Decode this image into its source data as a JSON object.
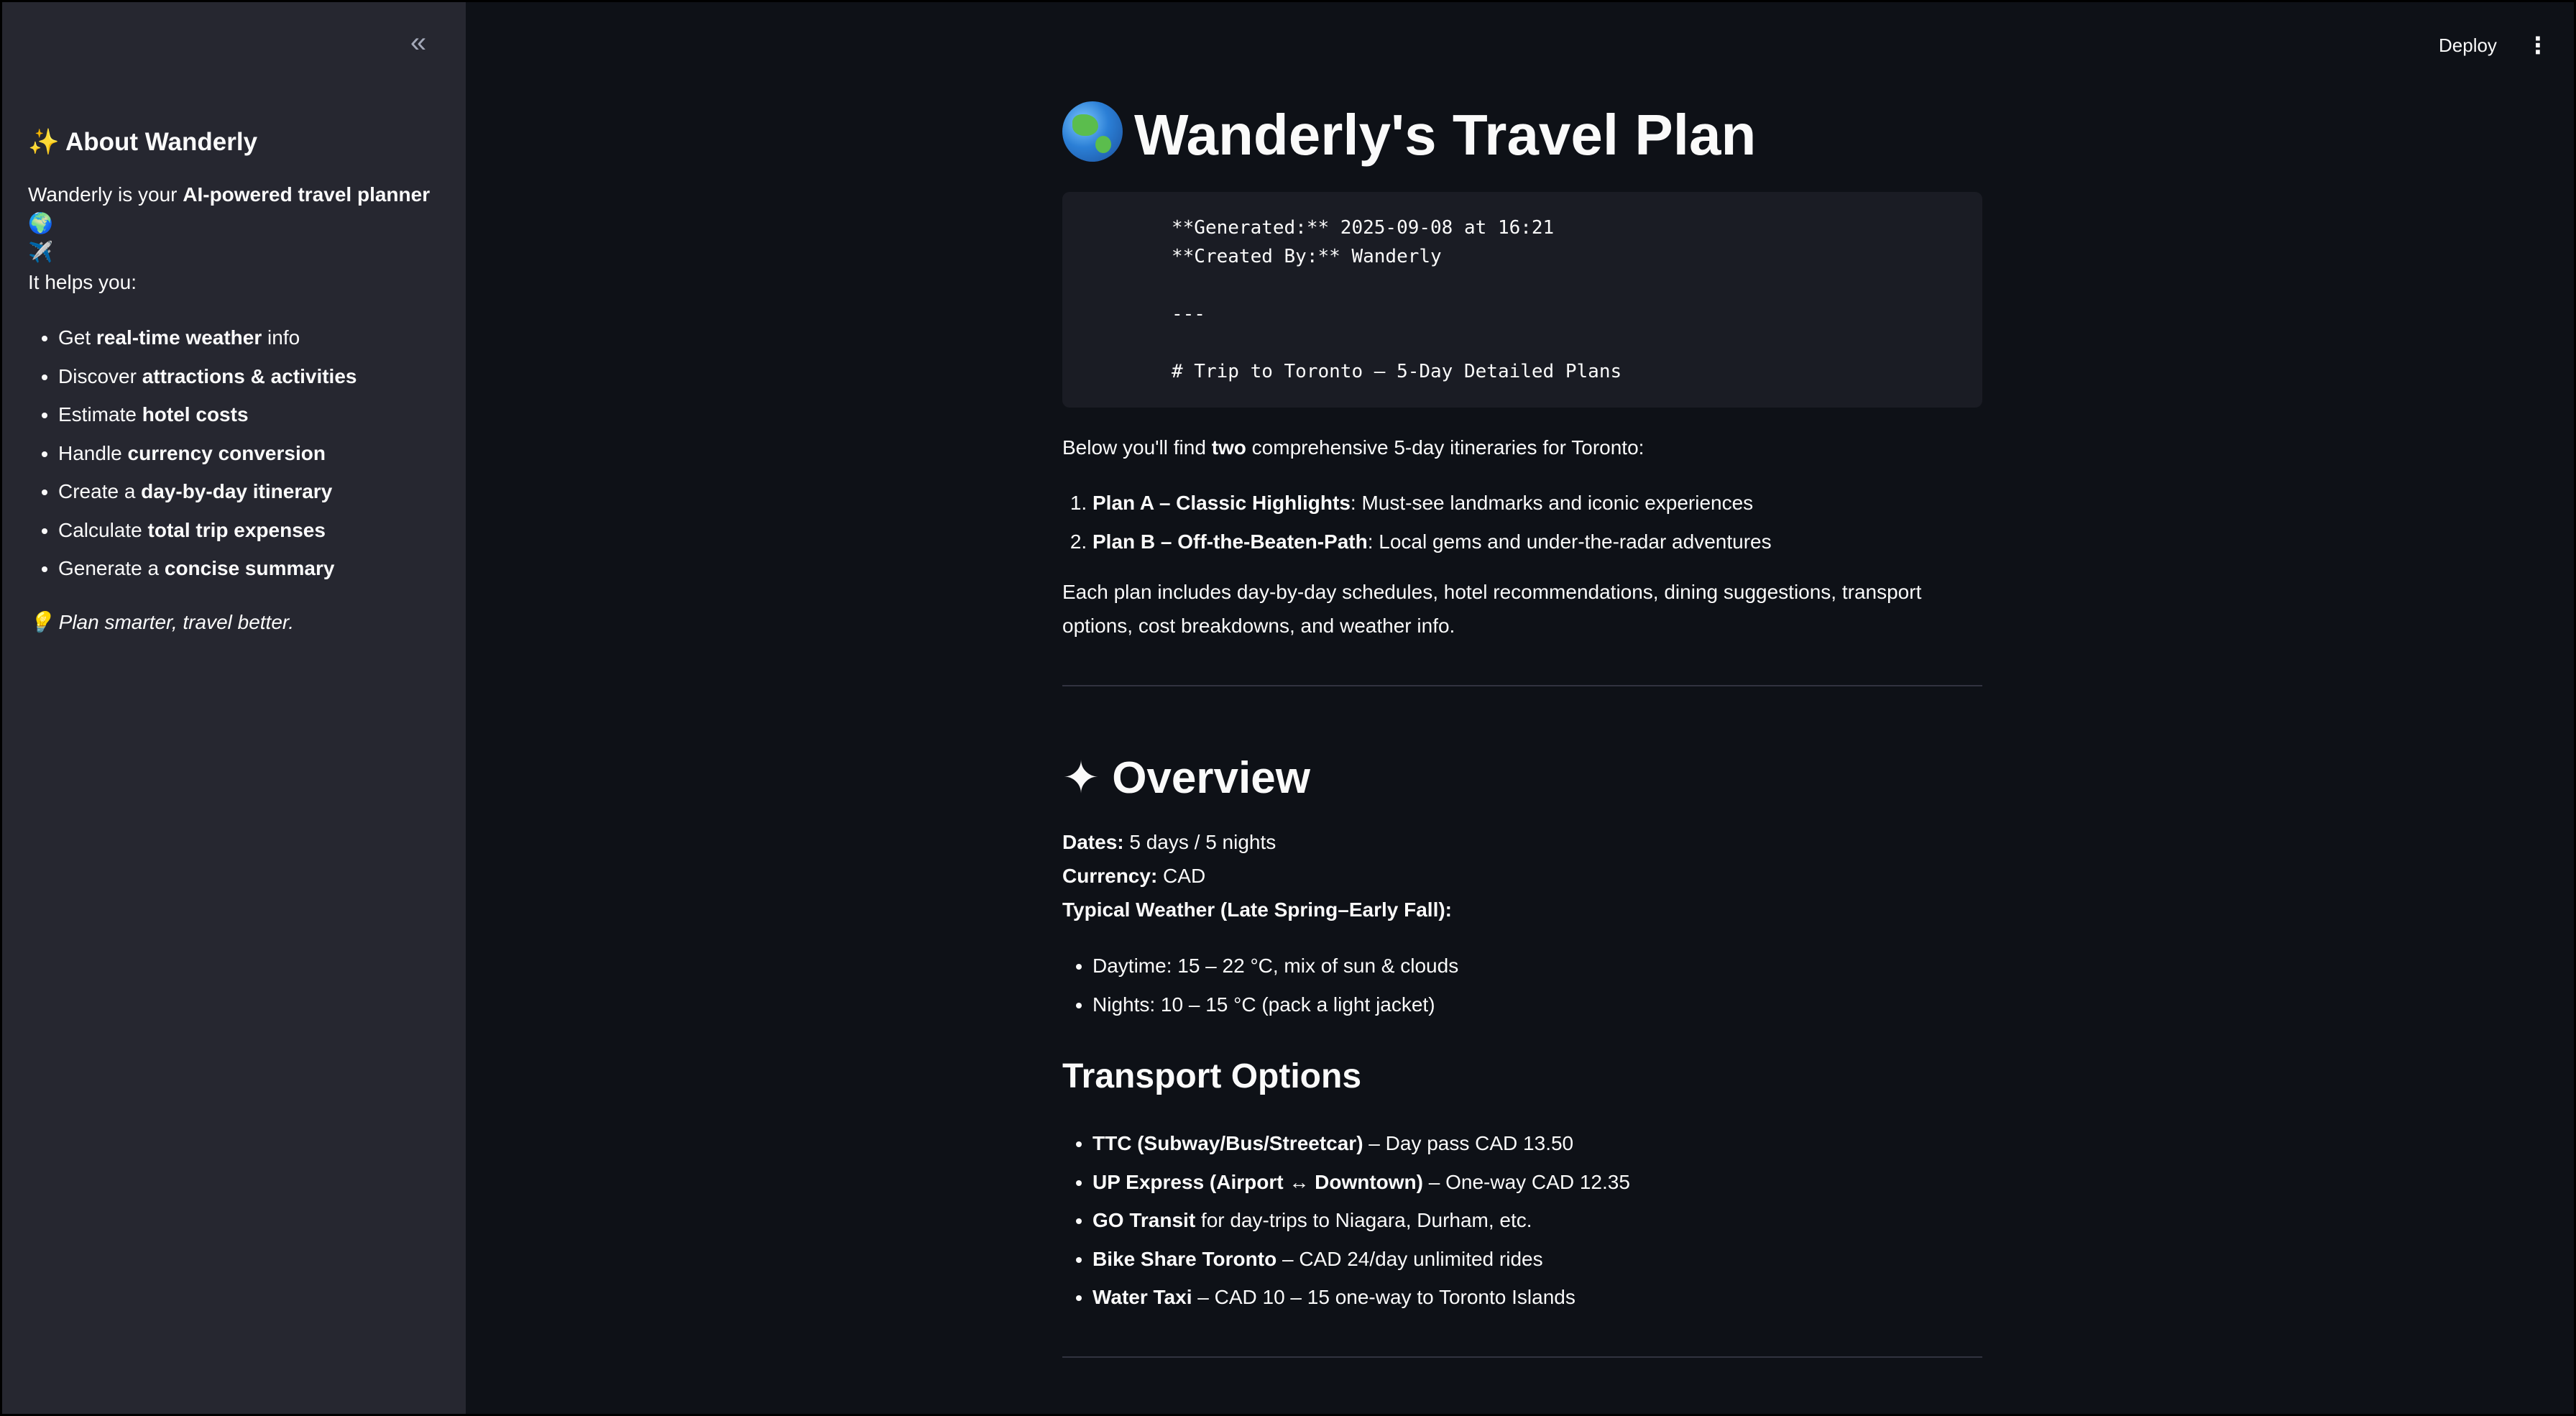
{
  "header": {
    "deploy_label": "Deploy",
    "menu_icon": "⋮"
  },
  "sidebar": {
    "collapse_icon": "«",
    "title": "✨ About Wanderly",
    "intro_prefix": "Wanderly is your ",
    "intro_bold": "AI-powered travel planner",
    "intro_emoji": " 🌍",
    "intro_plane": "✈️",
    "helps_label": "It helps you:",
    "items": [
      {
        "pre": "Get ",
        "bold": "real-time weather",
        "post": " info"
      },
      {
        "pre": "Discover ",
        "bold": "attractions & activities",
        "post": ""
      },
      {
        "pre": "Estimate ",
        "bold": "hotel costs",
        "post": ""
      },
      {
        "pre": "Handle ",
        "bold": "currency conversion",
        "post": ""
      },
      {
        "pre": "Create a ",
        "bold": "day-by-day itinerary",
        "post": ""
      },
      {
        "pre": "Calculate ",
        "bold": "total trip expenses",
        "post": ""
      },
      {
        "pre": "Generate a ",
        "bold": "concise summary",
        "post": ""
      }
    ],
    "tagline_icon": "💡",
    "tagline": "Plan smarter, travel better."
  },
  "main": {
    "title": "Wanderly's Travel Plan",
    "code_lines": [
      "**Generated:** 2025-09-08 at 16:21",
      "**Created By:** Wanderly",
      "",
      "---",
      "",
      "# Trip to Toronto – 5-Day Detailed Plans"
    ],
    "intro_pre": "Below you'll find ",
    "intro_bold": "two",
    "intro_post": " comprehensive 5-day itineraries for Toronto:",
    "plans": [
      {
        "bold": "Plan A – Classic Highlights",
        "text": ": Must-see landmarks and iconic experiences"
      },
      {
        "bold": "Plan B – Off-the-Beaten-Path",
        "text": ": Local gems and under-the-radar adventures"
      }
    ],
    "plans_desc": "Each plan includes day-by-day schedules, hotel recommendations, dining suggestions, transport options, cost breakdowns, and weather info.",
    "overview": {
      "icon": "✦",
      "heading": "Overview",
      "dates_label": "Dates:",
      "dates_value": " 5 days / 5 nights",
      "currency_label": "Currency:",
      "currency_value": " CAD",
      "weather_label": "Typical Weather (Late Spring–Early Fall):",
      "weather_items": [
        "Daytime: 15 – 22 °C, mix of sun & clouds",
        "Nights: 10 – 15 °C (pack a light jacket)"
      ]
    },
    "transport": {
      "heading": "Transport Options",
      "items": [
        {
          "bold": "TTC (Subway/Bus/Streetcar)",
          "text": " – Day pass CAD 13.50"
        },
        {
          "bold": "UP Express (Airport ↔ Downtown)",
          "text": " – One-way CAD 12.35"
        },
        {
          "bold": "GO Transit",
          "text": " for day-trips to Niagara, Durham, etc."
        },
        {
          "bold": "Bike Share Toronto",
          "text": " – CAD 24/day unlimited rides"
        },
        {
          "bold": "Water Taxi",
          "text": " – CAD 10 – 15 one-way to Toronto Islands"
        }
      ]
    }
  }
}
